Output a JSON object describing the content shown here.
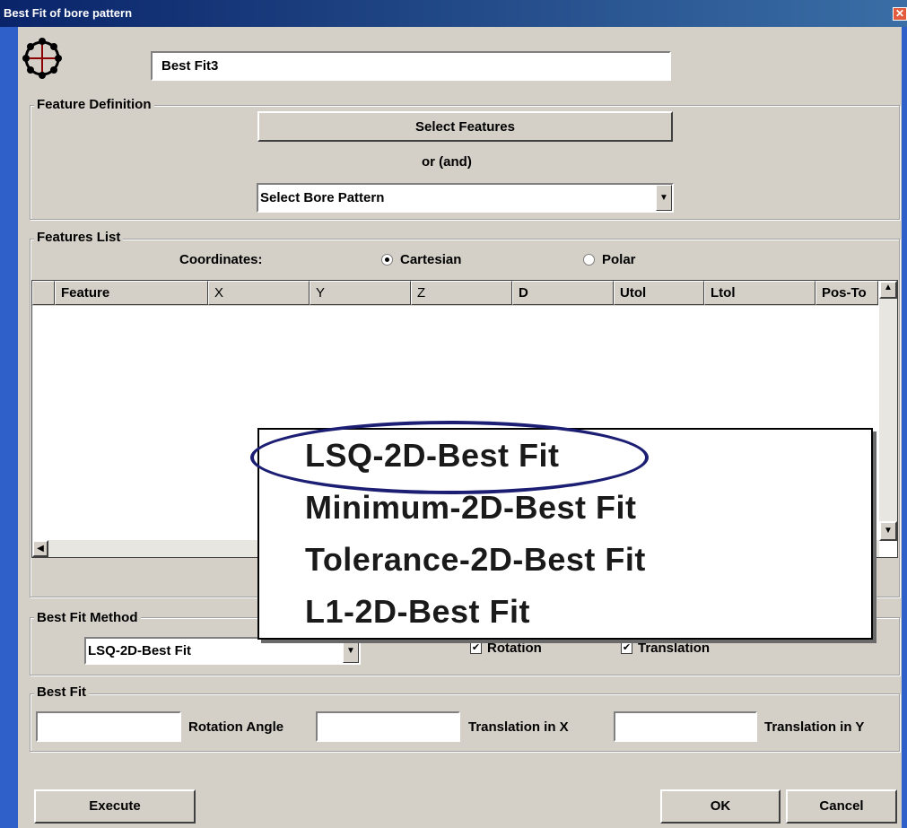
{
  "window": {
    "title": "Best Fit of bore pattern",
    "close_glyph": "✕"
  },
  "name_field": {
    "value": "Best Fit3"
  },
  "feature_definition": {
    "label": "Feature Definition",
    "select_features_label": "Select Features",
    "or_and_label": "or (and)",
    "bore_pattern_value": "Select Bore Pattern"
  },
  "features_list": {
    "label": "Features List",
    "coordinates_label": "Coordinates:",
    "cartesian_label": "Cartesian",
    "polar_label": "Polar",
    "coordinates_selected": "Cartesian",
    "columns": [
      "Feature",
      "X",
      "Y",
      "Z",
      "D",
      "Utol",
      "Ltol",
      "Pos-To"
    ]
  },
  "best_fit_method": {
    "label": "Best Fit Method",
    "selected_value": "LSQ-2D-Best Fit",
    "rotation_label": "Rotation",
    "rotation_checked": true,
    "translation_label": "Translation",
    "translation_checked": true
  },
  "best_fit": {
    "label": "Best Fit",
    "rotation_angle_label": "Rotation Angle",
    "translation_x_label": "Translation in X",
    "translation_y_label": "Translation in Y",
    "value1": "",
    "rotation_angle_value": "",
    "translation_x_value": ""
  },
  "buttons": {
    "execute": "Execute",
    "ok": "OK",
    "cancel": "Cancel"
  },
  "dropdown_popup": {
    "options": [
      "LSQ-2D-Best Fit",
      "Minimum-2D-Best Fit",
      "Tolerance-2D-Best Fit",
      "L1-2D-Best Fit"
    ],
    "highlighted_option": "LSQ-2D-Best Fit",
    "highlight_color": "#1b1e72"
  },
  "colors": {
    "title_bar": "#0a246a",
    "dialog_bg": "#d4d0c8",
    "side_stripe": "#2f5fc9"
  },
  "icons": {
    "app_icon": "bore-pattern-icon",
    "checkbox_mark": "✔",
    "combo_arrow": "▼",
    "scroll_left": "◀",
    "scroll_up": "▲",
    "scroll_down": "▼"
  }
}
